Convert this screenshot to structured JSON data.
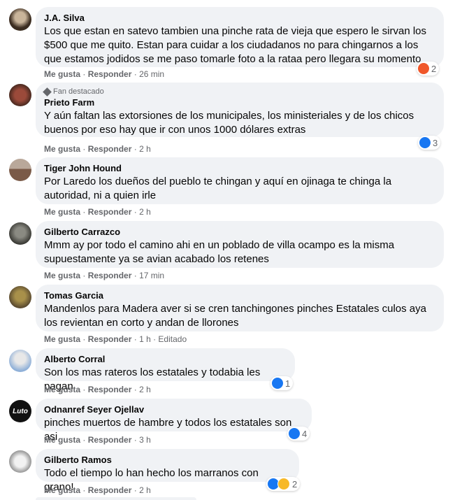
{
  "comments": [
    {
      "name": "J.A. Silva",
      "text": "Los que estan en satevo tambien una pinche rata de vieja que espero le sirvan los $500 que me quito. Estan para cuidar a los ciudadanos no para chingarnos a los que estamos jodidos se me paso tomarle foto a la rataa pero llegara su momento",
      "like": "Me gusta",
      "reply": "Responder",
      "time": "26 min",
      "reactions": "2",
      "badge": ""
    },
    {
      "name": "Prieto Farm",
      "text": "Y aún faltan las extorsiones de los municipales, los ministeriales y de los chicos buenos por eso hay que ir con unos 1000 dólares extras",
      "like": "Me gusta",
      "reply": "Responder",
      "time": "2 h",
      "reactions": "3",
      "badge": "Fan destacado"
    },
    {
      "name": "Tiger John Hound",
      "text": "Por Laredo los dueños del pueblo te chingan y aquí en ojinaga te chinga la autoridad, ni a quien irle",
      "like": "Me gusta",
      "reply": "Responder",
      "time": "2 h",
      "reactions": "",
      "badge": ""
    },
    {
      "name": "Gilberto Carrazco",
      "text": "Mmm ay por todo el camino ahi en un poblado de villa ocampo es la misma supuestamente ya se avian acabado los retenes",
      "like": "Me gusta",
      "reply": "Responder",
      "time": "17 min",
      "reactions": "",
      "badge": ""
    },
    {
      "name": "Tomas Garcia",
      "text": "Mandenlos para Madera aver si se cren tanchingones pinches Estatales culos aya los revientan en corto y andan de llorones",
      "like": "Me gusta",
      "reply": "Responder",
      "time": "1 h · Editado",
      "reactions": "",
      "badge": ""
    },
    {
      "name": "Alberto Corral",
      "text": "Son los mas rateros los estatales y todabia les pagan",
      "like": "Me gusta",
      "reply": "Responder",
      "time": "2 h",
      "reactions": "1",
      "badge": ""
    },
    {
      "name": "Odnanref Seyer Ojellav",
      "text": "pinches muertos de hambre y todos los estatales son asi",
      "like": "Me gusta",
      "reply": "Responder",
      "time": "3 h",
      "reactions": "4",
      "badge": ""
    },
    {
      "name": "Gilberto Ramos",
      "text": "Todo el tiempo lo han hecho los marranos con grano!",
      "like": "Me gusta",
      "reply": "Responder",
      "time": "2 h",
      "reactions": "2",
      "badge": ""
    }
  ],
  "avatar_texts": {
    "luto": "Luto"
  },
  "dot": "·",
  "colors": {
    "like": "#1877f2",
    "angry": "#f0572a",
    "haha": "#f7b928",
    "bubble": "#f0f2f5",
    "meta": "#65676b"
  }
}
